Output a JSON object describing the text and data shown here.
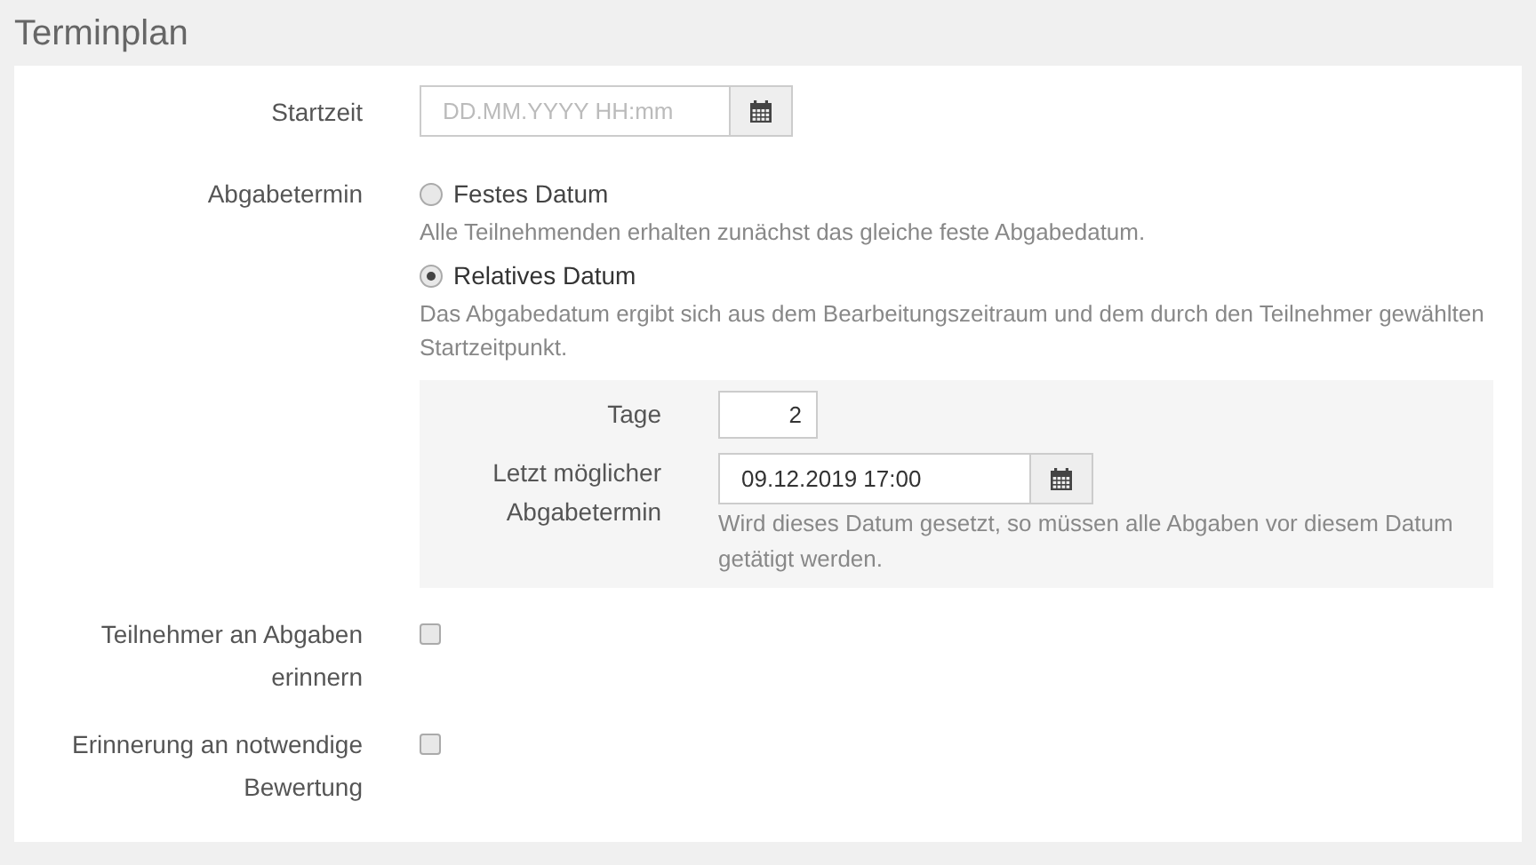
{
  "section_title": "Terminplan",
  "start": {
    "label": "Startzeit",
    "placeholder": "DD.MM.YYYY HH:mm"
  },
  "deadline": {
    "label": "Abgabetermin",
    "options": [
      {
        "label": "Festes Datum",
        "selected": false,
        "help": "Alle Teilnehmenden erhalten zunächst das gleiche feste Abgabedatum."
      },
      {
        "label": "Relatives Datum",
        "selected": true,
        "help": "Das Abgabedatum ergibt sich aus dem Bearbeitungszeitraum und dem durch den Teilnehmer gewählten Startzeitpunkt."
      }
    ],
    "relative": {
      "days_label": "Tage",
      "days_value": "2",
      "last_label": "Letzt möglicher Abgabetermin",
      "last_value": "09.12.2019 17:00",
      "last_help": "Wird dieses Datum gesetzt, so müssen alle Abgaben vor diesem Datum getätigt werden."
    }
  },
  "checkboxes": [
    {
      "label": "Teilnehmer an Abgaben erinnern",
      "checked": false
    },
    {
      "label": "Erinnerung an notwendige Bewertung",
      "checked": false
    }
  ]
}
